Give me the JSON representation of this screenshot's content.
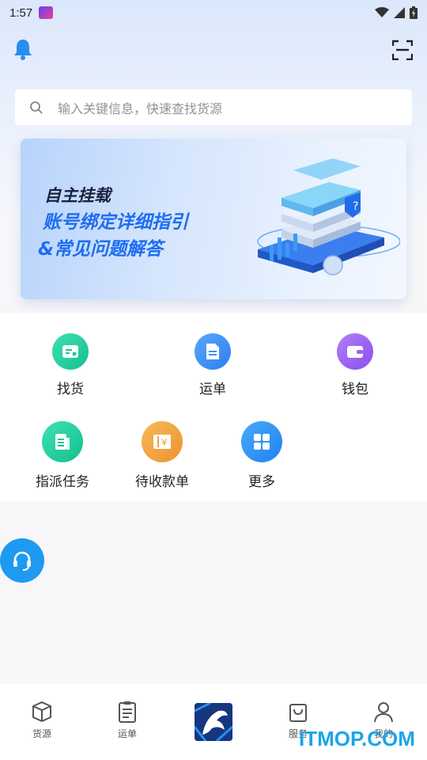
{
  "status_bar": {
    "time": "1:57"
  },
  "search": {
    "placeholder": "输入关键信息，快速查找货源"
  },
  "banner": {
    "line1": "自主挂载",
    "line2": "账号绑定详细指引",
    "line3": "&常见问题解答"
  },
  "menu": {
    "items": [
      {
        "label": "找货",
        "icon": "find-goods-icon",
        "color": "#1fd3a0"
      },
      {
        "label": "运单",
        "icon": "waybill-icon",
        "color": "#3a8ff5"
      },
      {
        "label": "钱包",
        "icon": "wallet-icon",
        "color": "#9b62f2"
      },
      {
        "label": "指派任务",
        "icon": "assign-task-icon",
        "color": "#1fd3a0"
      },
      {
        "label": "待收款单",
        "icon": "pending-payment-icon",
        "color": "#f2a03c"
      },
      {
        "label": "更多",
        "icon": "more-grid-icon",
        "color": "#2f92f2"
      }
    ]
  },
  "tabbar": {
    "tabs": [
      {
        "label": "货源",
        "icon": "box-icon"
      },
      {
        "label": "运单",
        "icon": "clipboard-icon"
      },
      {
        "label": "",
        "icon": "app-logo-icon"
      },
      {
        "label": "服务",
        "icon": "shopping-bag-icon"
      },
      {
        "label": "我的",
        "icon": "person-icon"
      }
    ]
  },
  "watermark": "ITMOP.COM",
  "colors": {
    "accent": "#1d6ef0",
    "support": "#1e9af0"
  }
}
